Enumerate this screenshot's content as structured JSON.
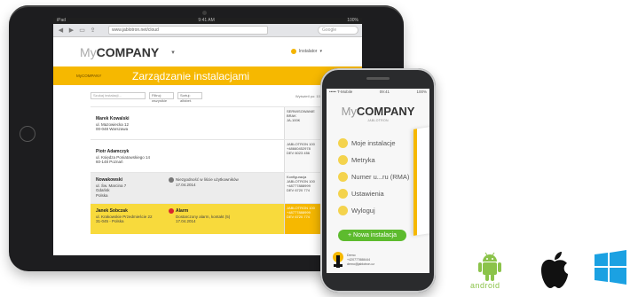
{
  "tablet": {
    "status": {
      "left": "iPad",
      "time": "9:41 AM",
      "right": "100%"
    },
    "browser": {
      "url": "www.jablotron.net/cloud",
      "search_placeholder": "Google"
    },
    "app": {
      "logo_my": "My",
      "logo_company": "COMPANY",
      "user": "Instalator"
    },
    "banner": {
      "crumb": "MyCOMPANY",
      "title": "Zarządzanie instalacjami"
    },
    "toolbar": {
      "search_placeholder": "Szukaj instalacji...",
      "filter1": "Filtruj: wszystkie",
      "filter2": "Sortuj: alfabet.",
      "pager": "Wyświetl po: 10 ▾"
    },
    "rows": [
      {
        "type": "white",
        "name": "Marek Kowalski",
        "line2": "ul. Mazowiecka 12",
        "line3": "00-048 Warszawa",
        "side": [
          "SERWISOWANIE",
          "BRAK",
          "JA-100K"
        ]
      },
      {
        "type": "white",
        "name": "Piotr Adamczyk",
        "line2": "ul. Księdza Poniatowskiego 14",
        "line3": "60-148 Poznań",
        "side": [
          "JABLOTRON 100",
          "+48660452978",
          "DEV 6023 456"
        ]
      },
      {
        "type": "gray",
        "name": "Nowakowski",
        "line2": "ul. Św. Marcina 7",
        "line3": "Gdańsk",
        "line4": "Polska",
        "event": "Niezgodność w liście użytkowników",
        "event_date": "17.04.2014",
        "side": [
          "Konfiguracja",
          "JABLOTRON 100",
          "+48777888999",
          "DEV 6720 774"
        ]
      },
      {
        "type": "yellow",
        "name": "Janek Sobczak",
        "line2": "ul. Krakowskie Przedmieście 22",
        "line3": "31-045 - Polska",
        "event": "Alarm",
        "event2": "Dostarczony alarm, kontakt (5)",
        "event_date": "17.04.2014",
        "side": [
          "JABLOTRON 100",
          "+48777888999",
          "DEV 6720 774"
        ]
      }
    ]
  },
  "phone": {
    "status": {
      "left": "••••• T-Mobile",
      "time": "09:41",
      "right": "100%"
    },
    "logo_my": "My",
    "logo_company": "COMPANY",
    "logo_sub": "JABLOTRON",
    "menu": [
      "Moje instalacje",
      "Metryka",
      "Numer u...ru (RMA)",
      "Ustawienia",
      "Wyloguj"
    ],
    "new_button": "+ Nowa instalacja",
    "footer": {
      "name": "Demo",
      "phone": "+420777888444",
      "email": "demo@jablotron.cz"
    }
  },
  "os": {
    "android_label": "android",
    "colors": {
      "android": "#8bc34a",
      "apple": "#111111",
      "windows": "#1ba1e2"
    }
  },
  "colors": {
    "accent": "#f6b800",
    "yellow_row": "#f8da3c",
    "new_button": "#5dbb2e"
  }
}
